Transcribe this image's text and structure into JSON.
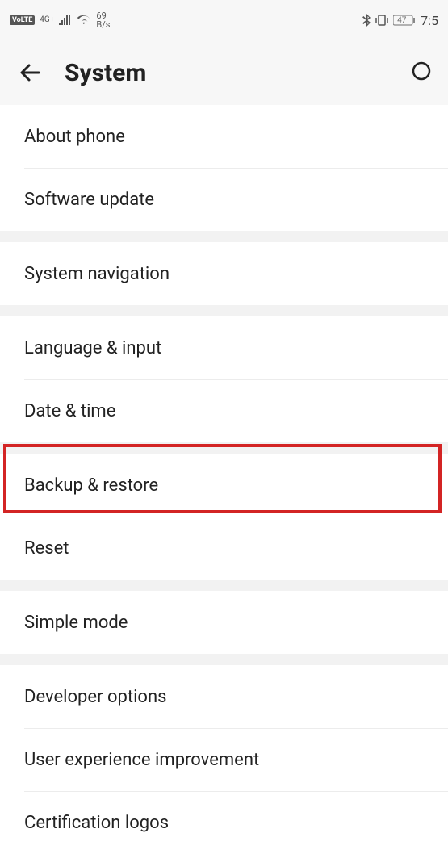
{
  "status": {
    "volte": "VoLTE",
    "net": "4G+",
    "net_sub": "1s",
    "speed_val": "69",
    "speed_unit": "B/s",
    "battery": "47",
    "time": "7:5"
  },
  "header": {
    "title": "System"
  },
  "sections": [
    {
      "rows": [
        {
          "id": "about-phone",
          "label": "About phone"
        },
        {
          "id": "software-update",
          "label": "Software update"
        }
      ]
    },
    {
      "rows": [
        {
          "id": "system-navigation",
          "label": "System navigation"
        }
      ]
    },
    {
      "rows": [
        {
          "id": "language-input",
          "label": "Language & input"
        },
        {
          "id": "date-time",
          "label": "Date & time"
        }
      ]
    },
    {
      "rows": [
        {
          "id": "backup-restore",
          "label": "Backup & restore"
        },
        {
          "id": "reset",
          "label": "Reset"
        }
      ]
    },
    {
      "rows": [
        {
          "id": "simple-mode",
          "label": "Simple mode"
        }
      ]
    },
    {
      "rows": [
        {
          "id": "developer-options",
          "label": "Developer options"
        },
        {
          "id": "ux-improvement",
          "label": "User experience improvement"
        },
        {
          "id": "certification-logos",
          "label": "Certification logos"
        }
      ]
    }
  ]
}
